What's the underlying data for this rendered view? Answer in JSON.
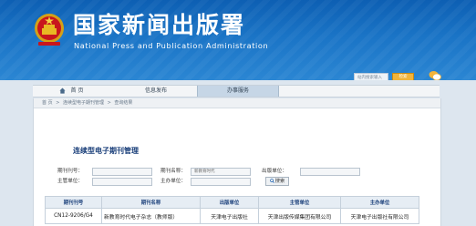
{
  "header": {
    "title_cn": "国家新闻出版署",
    "title_en": "National Press and Publication Administration",
    "search_placeholder": "站内搜索输入",
    "search_button": "检索"
  },
  "nav": {
    "home": "首 页",
    "info": "信息发布",
    "service": "办事服务"
  },
  "breadcrumb": [
    "首 页",
    ">",
    "连续型电子期刊管理",
    ">",
    "查询结果"
  ],
  "section_title": "连续型电子期刊管理",
  "form": {
    "issn_label": "期刊刊号：",
    "name_label": "期刊名称：",
    "name_value": "新教育时代",
    "publisher_label": "出版单位：",
    "supervisor_label": "主管单位：",
    "sponsor_label": "主办单位：",
    "query_button": "搜索"
  },
  "table": {
    "headers": [
      "期刊刊号",
      "期刊名称",
      "出版单位",
      "主管单位",
      "主办单位"
    ],
    "rows": [
      [
        "CN12-9206/G4",
        "新教育时代电子杂志（教师版）",
        "天津电子出版社",
        "天津出版传媒集团有限公司",
        "天津电子出版社有限公司"
      ]
    ]
  }
}
